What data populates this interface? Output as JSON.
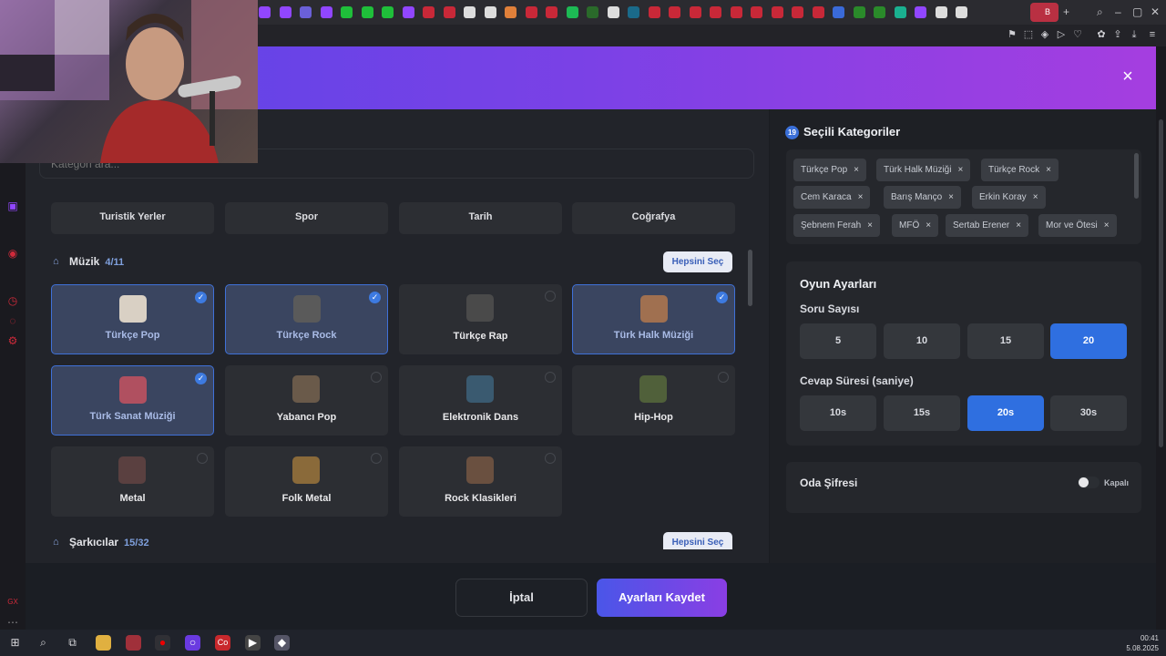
{
  "browser": {
    "active_tab_label": "B"
  },
  "modal": {
    "search_placeholder": "Kategori ara...",
    "top_row": [
      "Turistik Yerler",
      "Spor",
      "Tarih",
      "Coğrafya"
    ],
    "music_section": {
      "title": "Müzik",
      "count": "4/11",
      "select_all": "Hepsini Seç"
    },
    "music_cards": [
      {
        "label": "Türkçe Pop",
        "selected": true
      },
      {
        "label": "Türkçe Rock",
        "selected": true
      },
      {
        "label": "Türkçe Rap",
        "selected": false
      },
      {
        "label": "Türk Halk Müziği",
        "selected": true
      },
      {
        "label": "Türk Sanat Müziği",
        "selected": true
      },
      {
        "label": "Yabancı Pop",
        "selected": false
      },
      {
        "label": "Elektronik Dans",
        "selected": false
      },
      {
        "label": "Hip-Hop",
        "selected": false
      },
      {
        "label": "Metal",
        "selected": false
      },
      {
        "label": "Folk Metal",
        "selected": false
      },
      {
        "label": "Rock Klasikleri",
        "selected": false
      }
    ],
    "singers_section": {
      "title": "Şarkıcılar",
      "count": "15/32",
      "select_all": "Hepsini Seç"
    },
    "selected_panel": {
      "count": "19",
      "title": "Seçili Kategoriler",
      "tags": [
        "Türkçe Pop",
        "Türk Halk Müziği",
        "Türkçe Rock",
        "Cem Karaca",
        "Barış Manço",
        "Erkin Koray",
        "Şebnem Ferah",
        "MFÖ",
        "Sertab Erener",
        "Mor ve Ötesi"
      ],
      "tag_remove": "×"
    },
    "settings": {
      "title": "Oyun Ayarları",
      "question_label": "Soru Sayısı",
      "question_options": [
        "5",
        "10",
        "15",
        "20"
      ],
      "question_selected": "20",
      "time_label": "Cevap Süresi (saniye)",
      "time_options": [
        "10s",
        "15s",
        "20s",
        "30s"
      ],
      "time_selected": "20s"
    },
    "password": {
      "label": "Oda Şifresi",
      "toggle_state": "Kapalı"
    },
    "footer": {
      "cancel": "İptal",
      "save": "Ayarları Kaydet"
    },
    "close_icon": "×"
  },
  "taskbar": {
    "time": "00:41",
    "date": "5.08.2025"
  },
  "colors": {
    "accent": "#3d7ae0",
    "header_start": "#5a45e8",
    "header_end": "#a53ee0"
  }
}
